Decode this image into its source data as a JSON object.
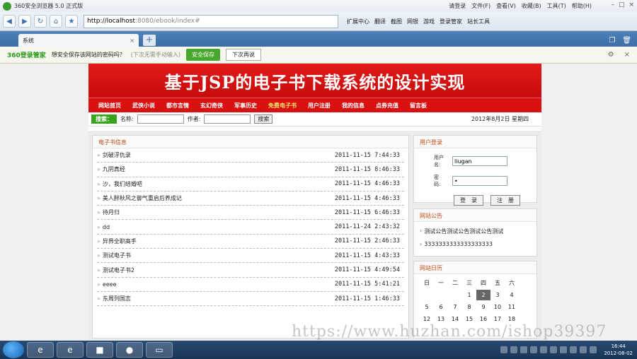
{
  "browser": {
    "title": "360安全浏览器 5.0 正式版",
    "menus": [
      "请登录",
      "文件(F)",
      "查看(V)",
      "收藏(B)",
      "工具(T)",
      "帮助(H)"
    ],
    "address_host": "http://localhost",
    "address_rest": ":8080/ebook/index#",
    "toolbar": [
      "扩展中心",
      "翻译",
      "截图",
      "网银",
      "游戏",
      "登录管家",
      "站长工具"
    ],
    "tab_label": "系统"
  },
  "password_bar": {
    "brand": "360登录管家",
    "question": "想安全保存该网站的密码吗？",
    "hint": "(下次无需手动输入)",
    "save": "安全保存",
    "later": "下次再说"
  },
  "site": {
    "title": "基于JSP的电子书下载系统的设计实现",
    "menu": [
      "网站首页",
      "武侠小说",
      "都市言情",
      "玄幻奇侠",
      "军事历史",
      "免费电子书",
      "用户注册",
      "我的信息",
      "点券充值",
      "留言板"
    ],
    "search": {
      "tag": "搜索：",
      "name_label": "名称:",
      "author_label": "作者:",
      "button": "搜索"
    },
    "date": "2012年8月2日 星期四"
  },
  "books": {
    "title": "电子书信息",
    "rows": [
      {
        "name": "剑破浮仇录",
        "time": "2011-11-15 7:44:33"
      },
      {
        "name": "九阴真经",
        "time": "2011-11-15 8:46:33"
      },
      {
        "name": "沙，我们结婚吧",
        "time": "2011-11-15 4:46:33"
      },
      {
        "name": "美人醉秋风之御气重启后养成记",
        "time": "2011-11-15 4:46:33"
      },
      {
        "name": "待月归",
        "time": "2011-11-15 6:46:33"
      },
      {
        "name": "dd",
        "time": "2011-11-24 2:43:32"
      },
      {
        "name": "异界全职高手",
        "time": "2011-11-15 2:46:33"
      },
      {
        "name": "测试电子书",
        "time": "2011-11-15 4:43:33"
      },
      {
        "name": "测试电子书2",
        "time": "2011-11-15 4:49:54"
      },
      {
        "name": "eeee",
        "time": "2011-11-15 5:41:21"
      },
      {
        "name": "东周列国志",
        "time": "2011-11-15 1:46:33"
      }
    ]
  },
  "login": {
    "title": "用户登录",
    "user_label": "用户名:",
    "user_value": "liugan",
    "pass_label": "密　码:",
    "pass_value": "•",
    "login_btn": "登　录",
    "register_btn": "注　册"
  },
  "notice": {
    "title": "网站公告",
    "items": [
      "测试公告测试公告测试公告测试",
      "3333333333333333333"
    ]
  },
  "calendar": {
    "title": "网站日历",
    "weekdays": [
      "日",
      "一",
      "二",
      "三",
      "四",
      "五",
      "六"
    ],
    "weeks": [
      [
        "",
        "",
        "",
        "1",
        "2",
        "3",
        "4"
      ],
      [
        "5",
        "6",
        "7",
        "8",
        "9",
        "10",
        "11"
      ],
      [
        "12",
        "13",
        "14",
        "15",
        "16",
        "17",
        "18"
      ]
    ],
    "today": "2"
  },
  "watermark": "https://www.huzhan.com/ishop39397",
  "taskbar": {
    "time": "16:44",
    "date": "2012-08-02"
  }
}
